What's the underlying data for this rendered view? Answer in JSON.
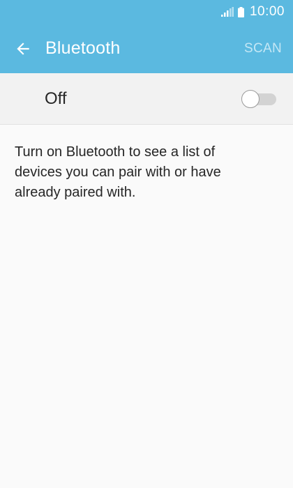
{
  "status_bar": {
    "time": "10:00",
    "signal_icon": "signal-icon",
    "battery_icon": "battery-icon"
  },
  "app_bar": {
    "back_icon": "arrow-back-icon",
    "title": "Bluetooth",
    "scan_label": "SCAN"
  },
  "bluetooth_toggle": {
    "label": "Off",
    "state": "off"
  },
  "description": "Turn on Bluetooth to see a list of devices you can pair with or have already paired with.",
  "colors": {
    "header": "#5bb9e0",
    "scan_disabled": "#c4e7f5",
    "toggle_row_bg": "#f2f2f2",
    "page_bg": "#fafafa",
    "text": "#262626"
  }
}
